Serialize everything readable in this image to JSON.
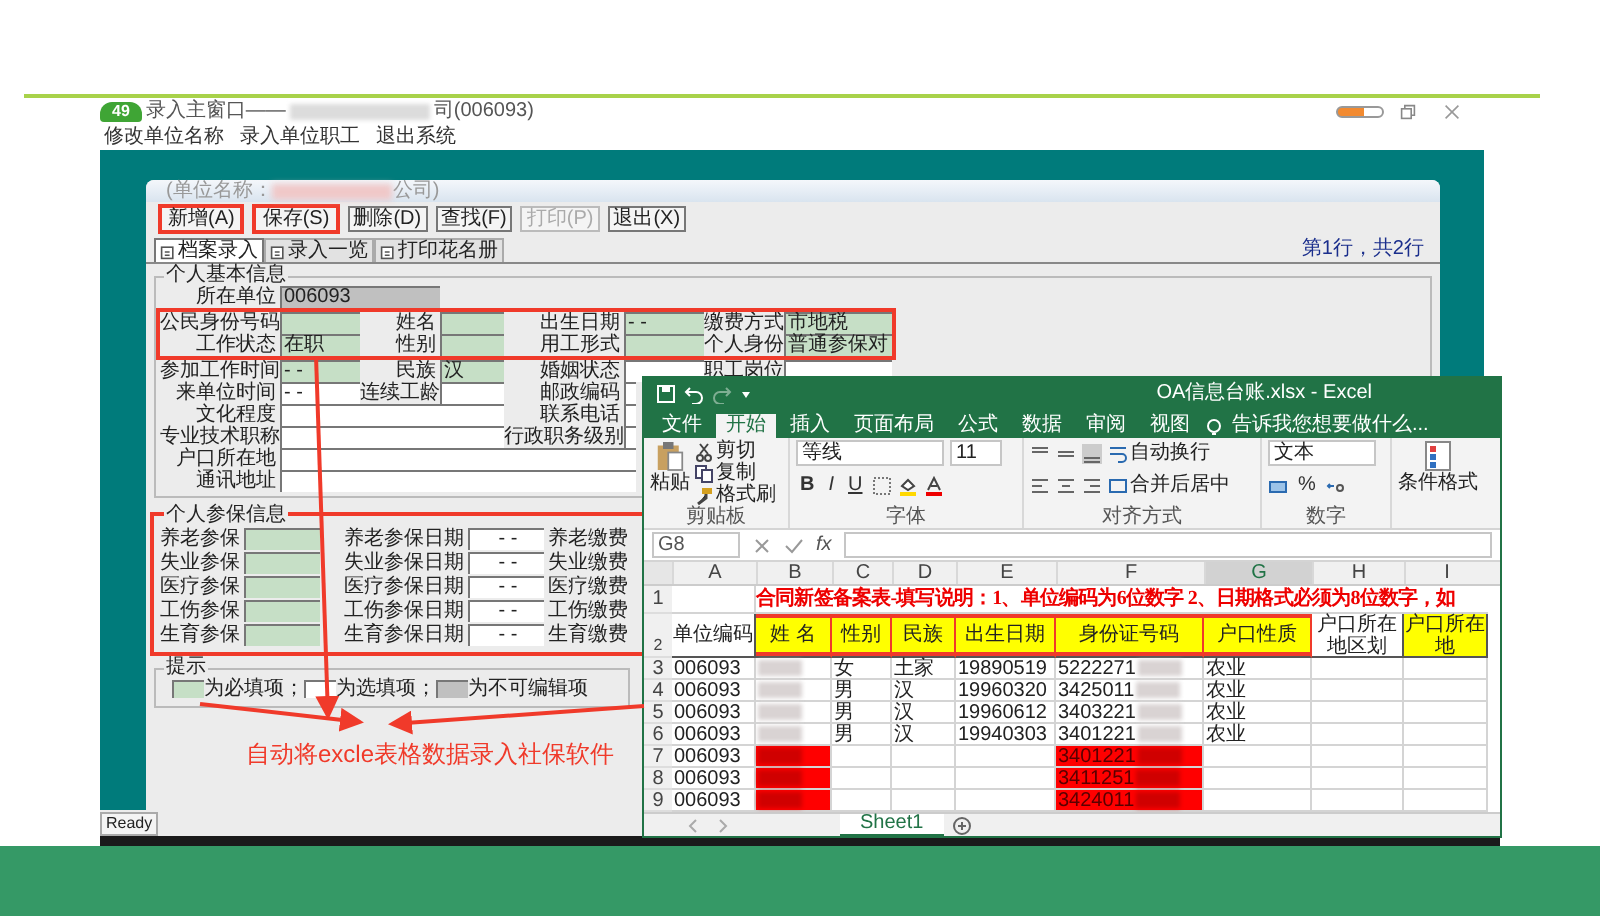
{
  "app": {
    "badge": "49",
    "title": "录入主窗口——",
    "title_suffix": "司(006093)",
    "menu": [
      "修改单位名称",
      "录入单位职工",
      "退出系统"
    ],
    "status": "Ready"
  },
  "form_window": {
    "company_prefix": "(单位名称：",
    "company_suffix": "公司)",
    "toolbar": [
      {
        "label": "新增(A)",
        "disabled": false,
        "highlight": true
      },
      {
        "label": "保存(S)",
        "disabled": false,
        "highlight": true
      },
      {
        "label": "删除(D)",
        "disabled": false,
        "highlight": false
      },
      {
        "label": "查找(F)",
        "disabled": false,
        "highlight": false
      },
      {
        "label": "打印(P)",
        "disabled": true,
        "highlight": false
      },
      {
        "label": "退出(X)",
        "disabled": false,
        "highlight": false
      }
    ],
    "record_info": "第1行，共2行",
    "tabs": [
      {
        "label": "档案录入",
        "selected": true
      },
      {
        "label": "录入一览",
        "selected": false
      },
      {
        "label": "打印花名册",
        "selected": false
      }
    ],
    "basic": {
      "title": "个人基本信息",
      "unit": {
        "label": "所在单位",
        "kind": "readonly",
        "value": "006093"
      },
      "highlight": true,
      "key_rows": [
        [
          {
            "label": "公民身份号码",
            "kind": "required"
          },
          {
            "label": "姓名",
            "kind": "required"
          },
          {
            "label": "出生日期",
            "kind": "required",
            "value": "-  -"
          },
          {
            "label": "缴费方式",
            "kind": "required",
            "value": "市地税"
          }
        ],
        [
          {
            "label": "工作状态",
            "kind": "required",
            "value": "在职"
          },
          {
            "label": "性别",
            "kind": "required"
          },
          {
            "label": "用工形式",
            "kind": "required"
          },
          {
            "label": "个人身份",
            "kind": "required",
            "value": "普通参保对"
          }
        ]
      ],
      "rows": [
        [
          {
            "label": "参加工作时间",
            "kind": "required",
            "value": "-  -"
          },
          {
            "label": "民族",
            "kind": "required",
            "value": "汉"
          },
          {
            "label": "婚姻状态",
            "kind": "optional"
          },
          {
            "label": "职工岗位",
            "kind": "optional"
          }
        ],
        [
          {
            "label": "来单位时间",
            "kind": "optional",
            "value": "-  -"
          },
          {
            "label": "连续工龄",
            "kind": "optional"
          },
          {
            "label": "邮政编码",
            "kind": "optional"
          }
        ],
        [
          {
            "label": "文化程度",
            "kind": "optional"
          },
          {
            "label": "联系电话",
            "kind": "optional"
          }
        ],
        [
          {
            "label": "专业技术职称",
            "kind": "optional"
          },
          {
            "label": "行政职务级别",
            "kind": "optional"
          }
        ],
        [
          {
            "label": "户口所在地",
            "kind": "optional"
          }
        ],
        [
          {
            "label": "通讯地址",
            "kind": "optional"
          }
        ]
      ]
    },
    "insurance": {
      "title": "个人参保信息",
      "highlight": true,
      "rows": [
        {
          "label": "养老参保",
          "date_label": "养老参保日期",
          "date_value": "-  -",
          "fee_label": "养老缴费"
        },
        {
          "label": "失业参保",
          "date_label": "失业参保日期",
          "date_value": "-  -",
          "fee_label": "失业缴费"
        },
        {
          "label": "医疗参保",
          "date_label": "医疗参保日期",
          "date_value": "-  -",
          "fee_label": "医疗缴费"
        },
        {
          "label": "工伤参保",
          "date_label": "工伤参保日期",
          "date_value": "-  -",
          "fee_label": "工伤缴费"
        },
        {
          "label": "生育参保",
          "date_label": "生育参保日期",
          "date_value": "-  -",
          "fee_label": "生育缴费"
        }
      ]
    },
    "legend": {
      "title": "提示",
      "items": [
        {
          "kind": "required",
          "text": "为必填项；"
        },
        {
          "kind": "optional",
          "text": "为选填项；"
        },
        {
          "kind": "readonly",
          "text": "为不可编辑项"
        }
      ]
    }
  },
  "excel": {
    "title": "OA信息台账.xlsx - Excel",
    "tabs": [
      {
        "label": "文件",
        "selected": false
      },
      {
        "label": "开始",
        "selected": true
      },
      {
        "label": "插入",
        "selected": false
      },
      {
        "label": "页面布局",
        "selected": false
      },
      {
        "label": "公式",
        "selected": false
      },
      {
        "label": "数据",
        "selected": false
      },
      {
        "label": "审阅",
        "selected": false
      },
      {
        "label": "视图",
        "selected": false
      }
    ],
    "tell_me": "告诉我您想要做什么...",
    "ribbon": {
      "paste": "粘贴",
      "cut": "剪切",
      "copy": "复制",
      "format_painter": "格式刷",
      "font_name": "等线",
      "font_size": "11",
      "font_styles": [
        "B",
        "I",
        "U"
      ],
      "wrap": "自动换行",
      "merge": "合并后居中",
      "number_format": "文本",
      "percent": "%",
      "conditional": "条件格式",
      "groups": [
        "剪贴板",
        "字体",
        "对齐方式",
        "数字"
      ]
    },
    "name_box": "G8",
    "fx": "fx",
    "columns": [
      {
        "label": "A",
        "selected": false
      },
      {
        "label": "B",
        "selected": false
      },
      {
        "label": "C",
        "selected": false
      },
      {
        "label": "D",
        "selected": false
      },
      {
        "label": "E",
        "selected": false
      },
      {
        "label": "F",
        "selected": false
      },
      {
        "label": "G",
        "selected": true
      },
      {
        "label": "H",
        "selected": false
      },
      {
        "label": "I",
        "selected": false
      }
    ],
    "title_row": {
      "number": "1",
      "text": "合同新签备案表-填写说明：1、单位编码为6位数字 2、日期格式必须为8位数字，如"
    },
    "header_row": {
      "number": "2",
      "cells": [
        {
          "text": "单位编码",
          "fill": false,
          "highlight": false
        },
        {
          "text": "姓  名",
          "fill": true,
          "highlight": true
        },
        {
          "text": "性别",
          "fill": true,
          "highlight": true
        },
        {
          "text": "民族",
          "fill": true,
          "highlight": true
        },
        {
          "text": "出生日期",
          "fill": true,
          "highlight": true
        },
        {
          "text": "身份证号码",
          "fill": true,
          "highlight": true
        },
        {
          "text": "户口性质",
          "fill": true,
          "highlight": true
        },
        {
          "text": "户口所在地区划",
          "fill": false,
          "highlight": false
        },
        {
          "text": "户口所在地",
          "fill": true,
          "highlight": false
        }
      ]
    },
    "rows": [
      {
        "number": "3",
        "cells": [
          {
            "text": "006093"
          },
          {
            "blurred": true
          },
          {
            "text": "女"
          },
          {
            "text": "土家"
          },
          {
            "text": "19890519"
          },
          {
            "text": "5222271",
            "blurred": true
          },
          {
            "text": "农业"
          },
          {},
          {}
        ]
      },
      {
        "number": "4",
        "cells": [
          {
            "text": "006093"
          },
          {
            "blurred": true
          },
          {
            "text": "男"
          },
          {
            "text": "汉"
          },
          {
            "text": "19960320"
          },
          {
            "text": "3425011",
            "blurred": true
          },
          {
            "text": "农业"
          },
          {},
          {}
        ]
      },
      {
        "number": "5",
        "cells": [
          {
            "text": "006093"
          },
          {
            "blurred": true
          },
          {
            "text": "男"
          },
          {
            "text": "汉"
          },
          {
            "text": "19960612"
          },
          {
            "text": "3403221",
            "blurred": true
          },
          {
            "text": "农业"
          },
          {},
          {}
        ]
      },
      {
        "number": "6",
        "cells": [
          {
            "text": "006093"
          },
          {
            "blurred": true
          },
          {
            "text": "男"
          },
          {
            "text": "汉"
          },
          {
            "text": "19940303"
          },
          {
            "text": "3401221",
            "blurred": true
          },
          {
            "text": "农业"
          },
          {},
          {}
        ]
      },
      {
        "number": "7",
        "cells": [
          {
            "text": "006093"
          },
          {
            "blurred": true,
            "error": true
          },
          {},
          {},
          {},
          {
            "text": "3401221",
            "blurred": true,
            "error": true
          },
          {},
          {},
          {}
        ]
      },
      {
        "number": "8",
        "cells": [
          {
            "text": "006093"
          },
          {
            "blurred": true,
            "error": true
          },
          {},
          {},
          {},
          {
            "text": "3411251",
            "blurred": true,
            "error": true
          },
          {},
          {},
          {}
        ]
      },
      {
        "number": "9",
        "cells": [
          {
            "text": "006093"
          },
          {
            "blurred": true,
            "error": true
          },
          {},
          {},
          {},
          {
            "text": "3424011",
            "blurred": true,
            "error": true
          },
          {},
          {},
          {}
        ]
      }
    ],
    "sheet_tab": "Sheet1"
  },
  "annotation": "自动将excle表格数据录入社保软件"
}
